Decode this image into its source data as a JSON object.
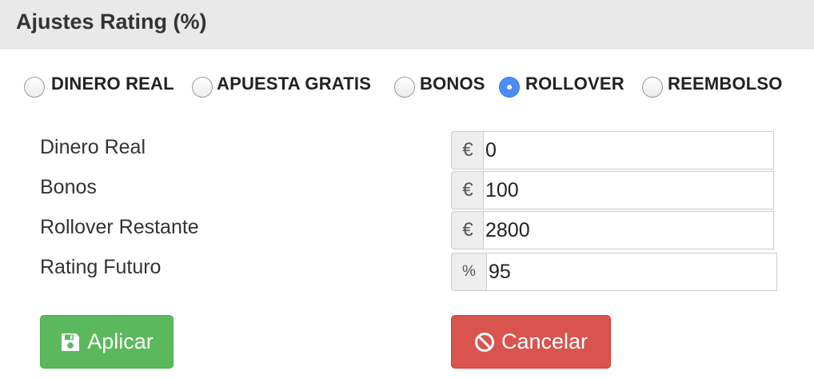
{
  "panel": {
    "title": "Ajustes Rating (%)"
  },
  "radio_options": [
    {
      "label": "DINERO REAL",
      "checked": false
    },
    {
      "label": "APUESTA GRATIS",
      "checked": false
    },
    {
      "label": "BONOS",
      "checked": false
    },
    {
      "label": "ROLLOVER",
      "checked": true
    },
    {
      "label": "REEMBOLSO",
      "checked": false
    }
  ],
  "fields": [
    {
      "label": "Dinero Real",
      "addon": "€",
      "value": "0"
    },
    {
      "label": "Bonos",
      "addon": "€",
      "value": "100"
    },
    {
      "label": "Rollover Restante",
      "addon": "€",
      "value": "2800"
    },
    {
      "label": "Rating Futuro",
      "addon": "%",
      "value": "95"
    }
  ],
  "buttons": {
    "apply_label": "Aplicar",
    "apply_icon": "floppy-disk-icon",
    "cancel_label": "Cancelar",
    "cancel_icon": "ban-icon"
  },
  "colors": {
    "apply": "#5cb85c",
    "cancel": "#d9534f",
    "radio_checked": "#4a8df8"
  }
}
